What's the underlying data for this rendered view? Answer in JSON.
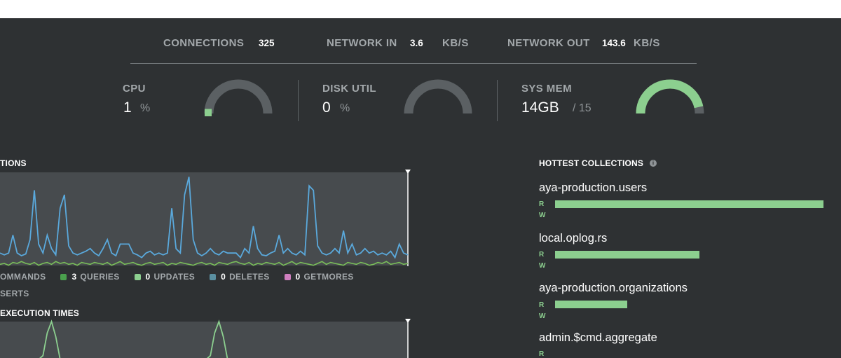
{
  "stats": {
    "connections_label": "CONNECTIONS",
    "connections_value": "325",
    "network_in_label": "NETWORK IN",
    "network_in_value": "3.6",
    "network_in_unit": "KB/S",
    "network_out_label": "NETWORK OUT",
    "network_out_value": "143.6",
    "network_out_unit": "KB/S"
  },
  "gauges": {
    "cpu": {
      "label": "CPU",
      "value": "1",
      "unit": "%",
      "fraction": 0.01
    },
    "disk": {
      "label": "DISK UTIL",
      "value": "0",
      "unit": "%",
      "fraction": 0
    },
    "mem": {
      "label": "SYS MEM",
      "value": "14GB",
      "unit": "/ 15",
      "fraction": 0.93
    }
  },
  "operations": {
    "title": "TIONS",
    "legend": [
      {
        "num": "",
        "label": "OMMANDS",
        "color": ""
      },
      {
        "num": "3",
        "label": "QUERIES",
        "color": "#4aa04d"
      },
      {
        "num": "0",
        "label": "UPDATES",
        "color": "#8ccf8f"
      },
      {
        "num": "0",
        "label": "DELETES",
        "color": "#5a8fa0"
      },
      {
        "num": "0",
        "label": "GETMORES",
        "color": "#cf7fbf"
      }
    ],
    "legend_row2": "SERTS"
  },
  "execution": {
    "title": "EXECUTION TIMES"
  },
  "hottest": {
    "title": "HOTTEST COLLECTIONS",
    "info_icon": "i",
    "read_label": "R",
    "write_label": "W",
    "collections": [
      {
        "name": "aya-production.users",
        "read_fraction": 1.0
      },
      {
        "name": "local.oplog.rs",
        "read_fraction": 0.537
      },
      {
        "name": "aya-production.organizations",
        "read_fraction": 0.268
      },
      {
        "name": "admin.$cmd.aggregate",
        "read_fraction": 0
      }
    ]
  },
  "chart_data": [
    {
      "type": "line",
      "title": "",
      "series": [
        {
          "color": "#5aa9dc",
          "values": [
            0.9,
            0.92,
            0.9,
            0.7,
            0.9,
            0.93,
            0.91,
            0.75,
            0.2,
            0.8,
            0.9,
            0.7,
            0.85,
            0.92,
            0.4,
            0.25,
            0.82,
            0.9,
            0.92,
            0.9,
            0.88,
            0.85,
            0.9,
            0.93,
            0.85,
            0.75,
            0.9,
            0.93,
            0.8,
            0.8,
            0.8,
            0.9,
            0.92,
            0.95,
            0.9,
            0.88,
            0.92,
            0.9,
            0.92,
            0.9,
            0.4,
            0.85,
            0.9,
            0.25,
            0.05,
            0.75,
            0.9,
            0.93,
            0.9,
            0.85,
            0.9,
            0.92,
            0.88,
            0.9,
            0.9,
            0.9,
            0.95,
            0.85,
            0.9,
            0.6,
            0.85,
            0.92,
            0.93,
            0.9,
            0.88,
            0.7,
            0.9,
            0.85,
            0.9,
            0.92,
            0.88,
            0.92,
            0.15,
            0.2,
            0.82,
            0.9,
            0.92,
            0.9,
            0.85,
            0.9,
            0.65,
            0.9,
            0.8,
            0.92,
            0.9,
            0.85,
            0.9,
            0.88,
            0.92,
            0.9,
            0.92,
            0.88,
            0.95,
            0.8,
            0.9,
            0.92
          ]
        },
        {
          "color": "#8ccf8f",
          "values": [
            0.98,
            0.97,
            0.99,
            0.96,
            0.97,
            0.95,
            0.97,
            0.98,
            0.96,
            0.99,
            0.97,
            0.96,
            0.98,
            0.95,
            0.97,
            0.96,
            0.98,
            0.97,
            0.99,
            0.96,
            0.97,
            0.98,
            0.96,
            0.97,
            0.98,
            0.96,
            0.99,
            0.97,
            0.95,
            0.98,
            0.97,
            0.96,
            0.98,
            0.99,
            0.97,
            0.96,
            0.98,
            0.97,
            0.96,
            0.99,
            0.97,
            0.98,
            0.96,
            0.97,
            0.98,
            0.99,
            0.97,
            0.96,
            0.98,
            0.97,
            0.99,
            0.96,
            0.97,
            0.98,
            0.96,
            0.95,
            0.97,
            0.98,
            0.96,
            0.99,
            0.97,
            0.98,
            0.96,
            0.97,
            0.98,
            0.96,
            0.99,
            0.97,
            0.95,
            0.98,
            0.96,
            0.97,
            0.98,
            0.99,
            0.97,
            0.95,
            0.98,
            0.96,
            0.97,
            0.98,
            0.99,
            0.96,
            0.97,
            0.98,
            0.96,
            0.97,
            0.99,
            0.98,
            0.96,
            0.97,
            0.95,
            0.98,
            0.97,
            0.96,
            0.98,
            0.97
          ]
        }
      ]
    },
    {
      "type": "line",
      "title": "",
      "series": [
        {
          "color": "#8ccf8f",
          "values": [
            1,
            1,
            1,
            1,
            1,
            1,
            1,
            1,
            1,
            1,
            0.9,
            0.3,
            0.0,
            0.4,
            1,
            1,
            1,
            1,
            1,
            1,
            1,
            1,
            1,
            1,
            1,
            1,
            1,
            1,
            1,
            1,
            1,
            1,
            1,
            1,
            1,
            1,
            1,
            1,
            1,
            1,
            1,
            1,
            1,
            1,
            1,
            1,
            1,
            1,
            1,
            0.9,
            0.3,
            0.0,
            0.4,
            1,
            1,
            1,
            1,
            1,
            1,
            1,
            1,
            1,
            1,
            1,
            1,
            1,
            1,
            1,
            1,
            1,
            1,
            1,
            1,
            1,
            1,
            1,
            1,
            1,
            1,
            1,
            1,
            1,
            1,
            1,
            1,
            1,
            1,
            1,
            1,
            1,
            1,
            1,
            1,
            1,
            1,
            1
          ]
        }
      ]
    }
  ]
}
